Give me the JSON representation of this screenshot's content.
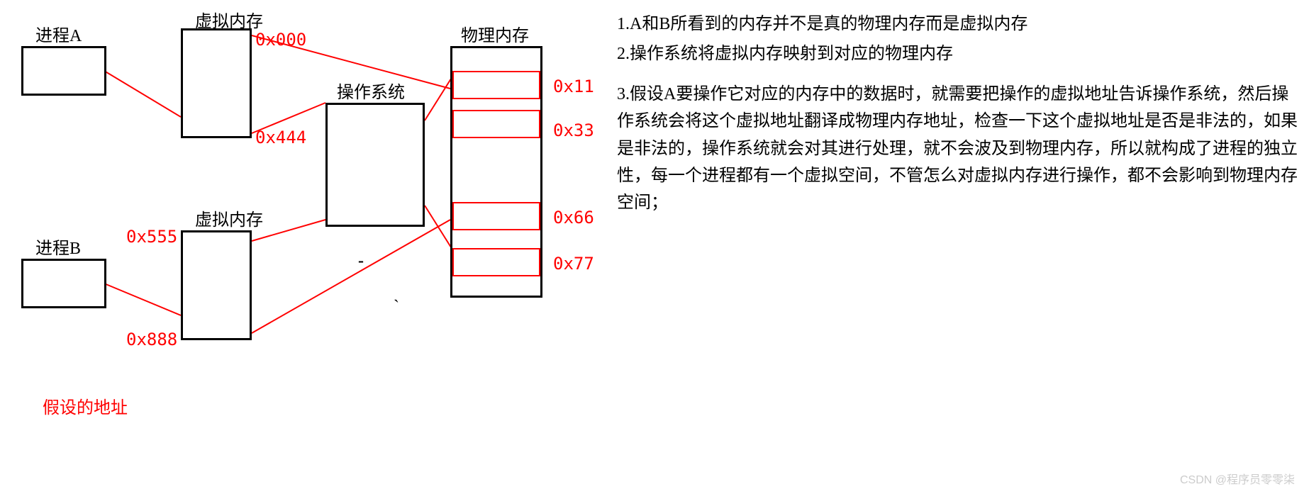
{
  "processA": {
    "label": "进程A"
  },
  "processB": {
    "label": "进程B"
  },
  "vmemA": {
    "label": "虚拟内存",
    "addrTop": "0x000",
    "addrBottom": "0x444"
  },
  "vmemB": {
    "label": "虚拟内存",
    "addrTop": "0x555",
    "addrBottom": "0x888"
  },
  "os": {
    "label": "操作系统"
  },
  "physmem": {
    "label": "物理内存",
    "addr1": "0x11",
    "addr2": "0x33",
    "addr3": "0x66",
    "addr4": "0x77"
  },
  "note": "假设的地址",
  "dash": "-",
  "tilde": "`",
  "explain": {
    "p1": "1.A和B所看到的内存并不是真的物理内存而是虚拟内存",
    "p2": "2.操作系统将虚拟内存映射到对应的物理内存",
    "p3": "3.假设A要操作它对应的内存中的数据时，就需要把操作的虚拟地址告诉操作系统，然后操作系统会将这个虚拟地址翻译成物理内存地址，检查一下这个虚拟地址是否是非法的，如果是非法的，操作系统就会对其进行处理，就不会波及到物理内存，所以就构成了进程的独立性，每一个进程都有一个虚拟空间，不管怎么对虚拟内存进行操作，都不会影响到物理内存空间；"
  },
  "watermark": "CSDN @程序员零零柒"
}
